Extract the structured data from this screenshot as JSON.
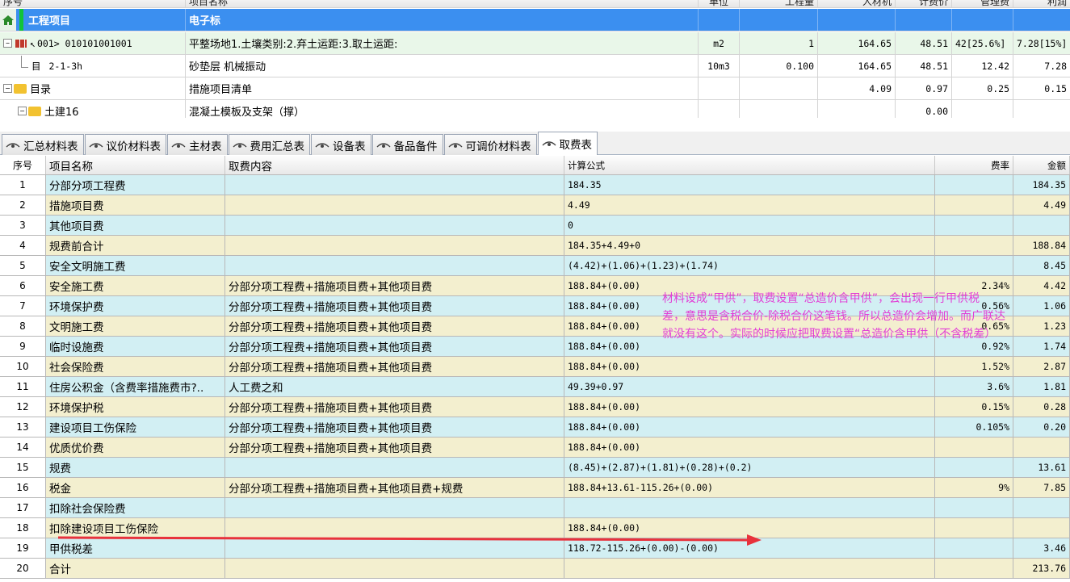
{
  "top_grid": {
    "headers": [
      "序号",
      "项目名称",
      "单位",
      "工程量",
      "人材机",
      "计费价",
      "管理费",
      "利润"
    ],
    "rows": [
      {
        "code": "工程项目",
        "name": "电子标",
        "unit": "",
        "qty": "",
        "rcj": "",
        "price": "",
        "mgmt": "",
        "profit": "",
        "selected": true
      },
      {
        "code": "001> 010101001001",
        "name": "平整场地1.土壤类别:2.弃土运距:3.取土运距:",
        "unit": "m2",
        "qty": "1",
        "rcj": "164.65",
        "price": "48.51",
        "mgmt": "42[25.6%]",
        "profit": "7.28[15%]"
      },
      {
        "code": "2-1-3h",
        "name": "砂垫层 机械振动",
        "unit": "10m3",
        "qty": "0.100",
        "rcj": "164.65",
        "price": "48.51",
        "mgmt": "12.42",
        "profit": "7.28"
      },
      {
        "code": "目录",
        "name": "措施项目清单",
        "unit": "",
        "qty": "",
        "rcj": "4.09",
        "price": "0.97",
        "mgmt": "0.25",
        "profit": "0.15"
      },
      {
        "code": "土建16",
        "name": "混凝土模板及支架（撑）",
        "unit": "",
        "qty": "",
        "rcj": "",
        "price": "0.00",
        "mgmt": "",
        "profit": ""
      }
    ]
  },
  "tabs": [
    "汇总材料表",
    "议价材料表",
    "主材表",
    "费用汇总表",
    "设备表",
    "备品备件",
    "可调价材料表",
    "取费表"
  ],
  "active_tab": "取费表",
  "fee_table": {
    "headers": [
      "序号",
      "项目名称",
      "取费内容",
      "计算公式",
      "费率",
      "金额"
    ],
    "rows": [
      {
        "no": "1",
        "name": "分部分项工程费",
        "content": "",
        "formula": "184.35",
        "rate": "",
        "amount": "184.35"
      },
      {
        "no": "2",
        "name": "措施项目费",
        "content": "",
        "formula": "4.49",
        "rate": "",
        "amount": "4.49"
      },
      {
        "no": "3",
        "name": "其他项目费",
        "content": "",
        "formula": "0",
        "rate": "",
        "amount": ""
      },
      {
        "no": "4",
        "name": "规费前合计",
        "content": "",
        "formula": "184.35+4.49+0",
        "rate": "",
        "amount": "188.84"
      },
      {
        "no": "5",
        "name": "安全文明施工费",
        "content": "",
        "formula": "(4.42)+(1.06)+(1.23)+(1.74)",
        "rate": "",
        "amount": "8.45"
      },
      {
        "no": "6",
        "name": "安全施工费",
        "content": "分部分项工程费+措施项目费+其他项目费",
        "formula": "188.84+(0.00)",
        "rate": "2.34%",
        "amount": "4.42"
      },
      {
        "no": "7",
        "name": "环境保护费",
        "content": "分部分项工程费+措施项目费+其他项目费",
        "formula": "188.84+(0.00)",
        "rate": "0.56%",
        "amount": "1.06"
      },
      {
        "no": "8",
        "name": "文明施工费",
        "content": "分部分项工程费+措施项目费+其他项目费",
        "formula": "188.84+(0.00)",
        "rate": "0.65%",
        "amount": "1.23"
      },
      {
        "no": "9",
        "name": "临时设施费",
        "content": "分部分项工程费+措施项目费+其他项目费",
        "formula": "188.84+(0.00)",
        "rate": "0.92%",
        "amount": "1.74"
      },
      {
        "no": "10",
        "name": "社会保险费",
        "content": "分部分项工程费+措施项目费+其他项目费",
        "formula": "188.84+(0.00)",
        "rate": "1.52%",
        "amount": "2.87"
      },
      {
        "no": "11",
        "name": "住房公积金（含费率措施费市?..",
        "content": "人工费之和",
        "formula": "49.39+0.97",
        "rate": "3.6%",
        "amount": "1.81"
      },
      {
        "no": "12",
        "name": "环境保护税",
        "content": "分部分项工程费+措施项目费+其他项目费",
        "formula": "188.84+(0.00)",
        "rate": "0.15%",
        "amount": "0.28"
      },
      {
        "no": "13",
        "name": "建设项目工伤保险",
        "content": "分部分项工程费+措施项目费+其他项目费",
        "formula": "188.84+(0.00)",
        "rate": "0.105%",
        "amount": "0.20"
      },
      {
        "no": "14",
        "name": "优质优价费",
        "content": "分部分项工程费+措施项目费+其他项目费",
        "formula": "188.84+(0.00)",
        "rate": "",
        "amount": ""
      },
      {
        "no": "15",
        "name": "规费",
        "content": "",
        "formula": "(8.45)+(2.87)+(1.81)+(0.28)+(0.2)",
        "rate": "",
        "amount": "13.61"
      },
      {
        "no": "16",
        "name": "税金",
        "content": "分部分项工程费+措施项目费+其他项目费+规费",
        "formula": "188.84+13.61-115.26+(0.00)",
        "rate": "9%",
        "amount": "7.85"
      },
      {
        "no": "17",
        "name": "扣除社会保险费",
        "content": "",
        "formula": "",
        "rate": "",
        "amount": ""
      },
      {
        "no": "18",
        "name": "扣除建设项目工伤保险",
        "content": "",
        "formula": "188.84+(0.00)",
        "rate": "",
        "amount": ""
      },
      {
        "no": "19",
        "name": "甲供税差",
        "content": "",
        "formula": "118.72-115.26+(0.00)-(0.00)",
        "rate": "",
        "amount": "3.46"
      },
      {
        "no": "20",
        "name": "合计",
        "content": "",
        "formula": "",
        "rate": "",
        "amount": "213.76"
      }
    ]
  },
  "annotation": "材料设成“甲供”，取费设置“总造价含甲供”，会出现一行甲供税\n差，意思是含税合价-除税合价这笔钱。所以总造价会增加。而广联达\n就没有这个。实际的时候应把取费设置“总造价含甲供（不含税差）",
  "colors": {
    "selected_row": "#3b8ff0",
    "odd_row": "#d2eff3",
    "even_row": "#f3efcf",
    "annotation": "#e23fd6",
    "arrow": "#e8323c"
  }
}
